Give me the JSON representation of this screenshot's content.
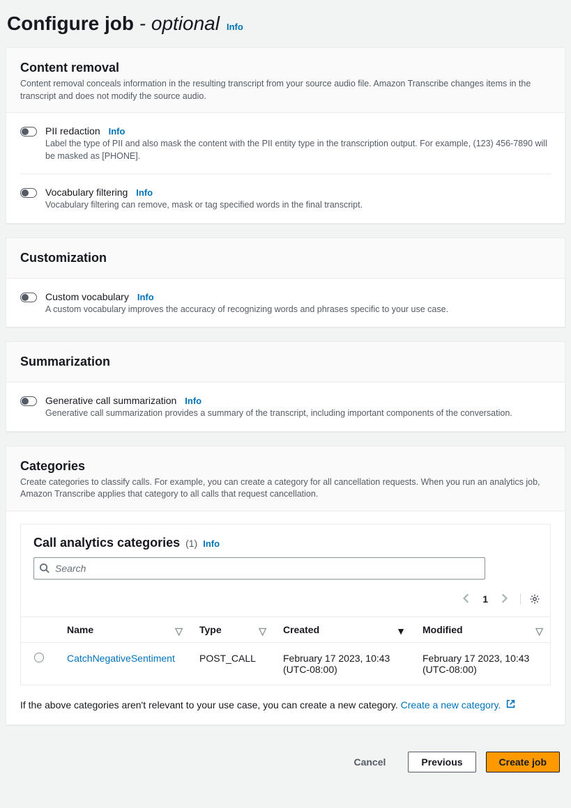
{
  "page": {
    "title_main": "Configure job ",
    "title_optional": "- optional",
    "info_label": "Info"
  },
  "content_removal": {
    "title": "Content removal",
    "description": "Content removal conceals information in the resulting transcript from your source audio file. Amazon Transcribe changes items in the transcript and does not modify the source audio.",
    "pii": {
      "label": "PII redaction",
      "info": "Info",
      "description": "Label the type of PII and also mask the content with the PII entity type in the transcription output. For example, (123) 456-7890 will be masked as [PHONE]."
    },
    "vocab": {
      "label": "Vocabulary filtering",
      "info": "Info",
      "description": "Vocabulary filtering can remove, mask or tag specified words in the final transcript."
    }
  },
  "customization": {
    "title": "Customization",
    "custom_vocab": {
      "label": "Custom vocabulary",
      "info": "Info",
      "description": "A custom vocabulary improves the accuracy of recognizing words and phrases specific to your use case."
    }
  },
  "summarization": {
    "title": "Summarization",
    "gen": {
      "label": "Generative call summarization",
      "info": "Info",
      "description": "Generative call summarization provides a summary of the transcript, including important components of the conversation."
    }
  },
  "categories": {
    "title": "Categories",
    "description": "Create categories to classify calls. For example, you can create a category for all cancellation requests. When you run an analytics job, Amazon Transcribe applies that category to all calls that request cancellation.",
    "table_title": "Call analytics categories",
    "count": "(1)",
    "info": "Info",
    "search_placeholder": "Search",
    "page_number": "1",
    "columns": {
      "name": "Name",
      "type": "Type",
      "created": "Created",
      "modified": "Modified"
    },
    "row": {
      "name": "CatchNegativeSentiment",
      "type": "POST_CALL",
      "created": "February 17 2023, 10:43 (UTC-08:00)",
      "modified": "February 17 2023, 10:43 (UTC-08:00)"
    },
    "note_prefix": "If the above categories aren't relevant to your use case, you can create a new category. ",
    "create_link": "Create a new category."
  },
  "footer": {
    "cancel": "Cancel",
    "previous": "Previous",
    "create": "Create job"
  }
}
